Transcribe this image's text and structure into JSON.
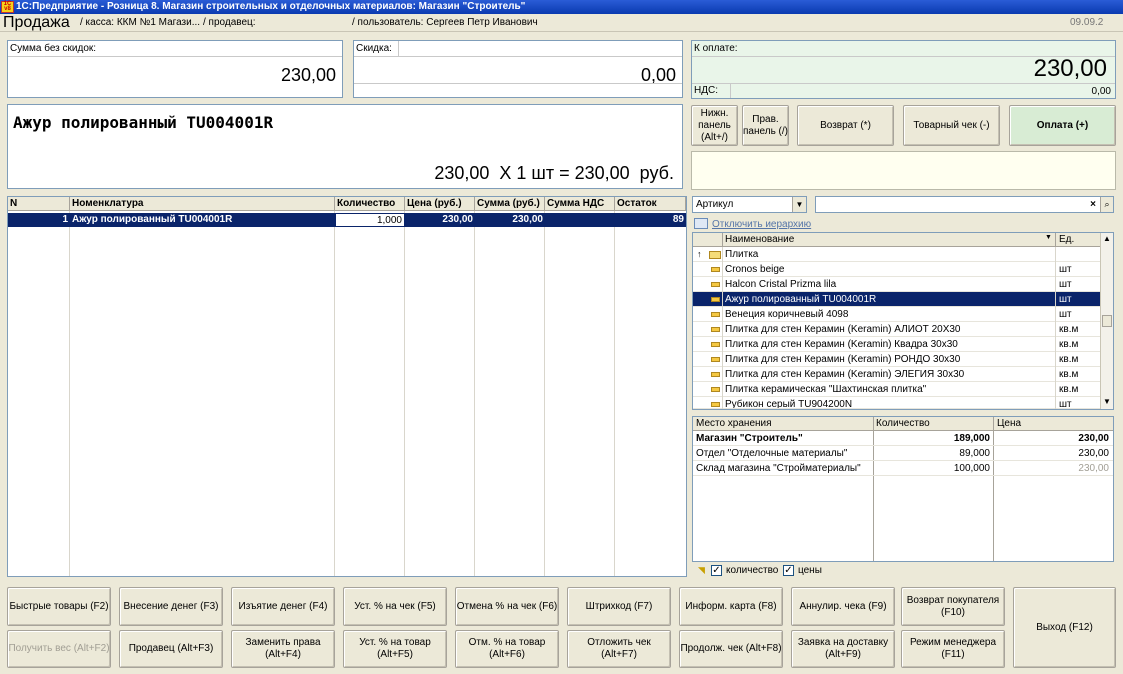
{
  "window": {
    "title": "1С:Предприятие - Розница 8. Магазин строительных и отделочных материалов: Магазин \"Строитель\"",
    "icon_text": "1С v8"
  },
  "header": {
    "title": "Продажа",
    "kassa": "/ касса: ККМ №1 Магази...",
    "seller": "/ продавец:",
    "user": "/ пользователь: Сергеев Петр Иванович",
    "date": "09.09.2"
  },
  "totals": {
    "sum_label": "Сумма без скидок:",
    "sum_value": "230,00",
    "discount_label": "Скидка:",
    "discount_value": "0,00",
    "pay_label": "К оплате:",
    "pay_value": "230,00",
    "vat_label": "НДС:",
    "vat_value": "0,00"
  },
  "display": {
    "item": "Ажур полированный TU004001R",
    "calc": "230,00  X 1 шт = 230,00  руб."
  },
  "top_buttons": {
    "bottom_panel": "Нижн. панель (Alt+/)",
    "right_panel": "Прав. панель (/)",
    "return": "Возврат (*)",
    "receipt": "Товарный чек (-)",
    "payment": "Оплата (+)"
  },
  "table": {
    "columns": [
      "N",
      "Номенклатура",
      "Количество",
      "Цена (руб.)",
      "Сумма (руб.)",
      "Сумма НДС",
      "Остаток"
    ],
    "rows": [
      {
        "n": "1",
        "name": "Ажур полированный TU004001R",
        "qty": "1,000",
        "price": "230,00",
        "sum": "230,00",
        "vat": "",
        "rest": "89"
      }
    ]
  },
  "search": {
    "mode": "Артикул",
    "value": "",
    "hierarchy_link": "Отключить иерархию"
  },
  "catalog": {
    "col_name": "Наименование",
    "col_unit": "Ед.",
    "folder": "Плитка",
    "items": [
      {
        "name": "Cronos beige",
        "unit": "шт"
      },
      {
        "name": "Halcon Cristal Prizma lila",
        "unit": "шт"
      },
      {
        "name": "Ажур полированный TU004001R",
        "unit": "шт"
      },
      {
        "name": "Венеция коричневый 4098",
        "unit": "шт"
      },
      {
        "name": "Плитка для стен Керамин (Keramin) АЛИОТ 20Х30",
        "unit": "кв.м"
      },
      {
        "name": "Плитка для стен Керамин (Keramin) Квадра 30х30",
        "unit": "кв.м"
      },
      {
        "name": "Плитка для стен Керамин (Keramin) РОНДО 30х30",
        "unit": "кв.м"
      },
      {
        "name": "Плитка для стен Керамин (Keramin) ЭЛЕГИЯ 30х30",
        "unit": "кв.м"
      },
      {
        "name": "Плитка керамическая \"Шахтинская плитка\"",
        "unit": "кв.м"
      },
      {
        "name": "Рубикон серый TU904200N",
        "unit": "шт"
      }
    ]
  },
  "stock": {
    "columns": [
      "Место хранения",
      "Количество",
      "Цена"
    ],
    "rows": [
      {
        "place": "Магазин \"Строитель\"",
        "qty": "189,000",
        "price": "230,00"
      },
      {
        "place": "Отдел \"Отделочные материалы\"",
        "qty": "89,000",
        "price": "230,00"
      },
      {
        "place": "Склад магазина \"Стройматериалы\"",
        "qty": "100,000",
        "price": "230,00"
      }
    ],
    "chk_qty": "количество",
    "chk_price": "цены"
  },
  "fkeys": {
    "row1": [
      "Быстрые товары (F2)",
      "Внесение денег (F3)",
      "Изъятие денег (F4)",
      "Уст. % на чек (F5)",
      "Отмена % на чек (F6)",
      "Штрихкод (F7)",
      "Информ. карта (F8)",
      "Аннулир. чека (F9)",
      "Возврат покупателя (F10)"
    ],
    "row2": [
      "Получить вес (Alt+F2)",
      "Продавец (Alt+F3)",
      "Заменить права (Alt+F4)",
      "Уст. % на товар (Alt+F5)",
      "Отм. % на товар (Alt+F6)",
      "Отложить чек (Alt+F7)",
      "Продолж. чек (Alt+F8)",
      "Заявка на доставку (Alt+F9)",
      "Режим менеджера (F11)"
    ],
    "exit": "Выход (F12)"
  }
}
